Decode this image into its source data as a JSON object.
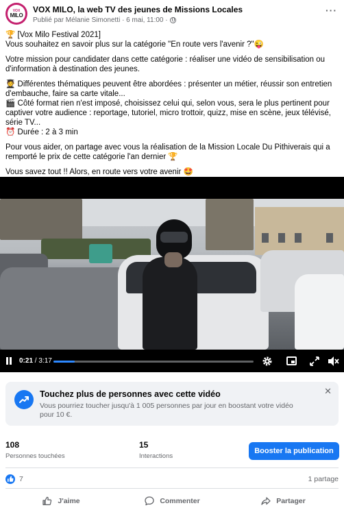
{
  "header": {
    "page_name": "VOX MILO, la web TV des jeunes de Missions Locales",
    "subtitle": "Publié par Mélanie Simonetti · 6 mai, 11:00 ·",
    "avatar_text_top": "VOX",
    "avatar_text_main": "MILO"
  },
  "post": {
    "lines": [
      "🏆 [Vox Milo Festival 2021]",
      "Vous souhaitez en savoir plus sur la catégorie \"En route vers l'avenir ?\"😜",
      "Votre mission pour candidater dans cette catégorie : réaliser une vidéo de sensibilisation ou d'information à destination des jeunes.",
      "🧑‍🎓 Différentes thématiques peuvent être abordées : présenter un métier, réussir son entretien d'embauche, faire sa carte vitale...",
      "🎬 Côté format rien n'est imposé, choisissez celui qui, selon vous, sera le plus pertinent pour captiver votre audience : reportage, tutoriel, micro trottoir, quizz, mise en scène, jeux télévisé, série TV...",
      "⏰ Durée : 2 à 3 min",
      "Pour vous aider, on partage avec vous la réalisation de la Mission Locale Du Pithiverais qui a remporté le prix de cette catégorie l'an dernier 🏆",
      "Vous savez tout !! Alors, en route vers votre avenir 🤩"
    ]
  },
  "video": {
    "current_time": "0:21",
    "duration": "3:17",
    "progress_fraction": 0.106
  },
  "boost_card": {
    "title": "Touchez plus de personnes avec cette vidéo",
    "description": "Vous pourriez toucher jusqu'à 1 005 personnes par jour en boostant votre vidéo pour 10 €.",
    "close_glyph": "✕"
  },
  "stats": {
    "reached_value": "108",
    "reached_label": "Personnes touchées",
    "interactions_value": "15",
    "interactions_label": "Interactions",
    "boost_button_label": "Booster la publication"
  },
  "reactions": {
    "count": "7",
    "shares": "1 partage"
  },
  "actions": {
    "like": "J'aime",
    "comment": "Commenter",
    "share": "Partager"
  },
  "colors": {
    "accent": "#1877f2",
    "muted_text": "#65676b",
    "card_bg": "#f0f2f5",
    "brand": "#c4206e"
  },
  "icons": [
    "more-icon",
    "globe-icon",
    "pause-icon",
    "gear-icon",
    "pip-icon",
    "expand-icon",
    "mute-icon",
    "trending-icon",
    "close-icon",
    "like-reaction-icon",
    "thumbs-up-icon",
    "comment-icon",
    "share-icon"
  ]
}
